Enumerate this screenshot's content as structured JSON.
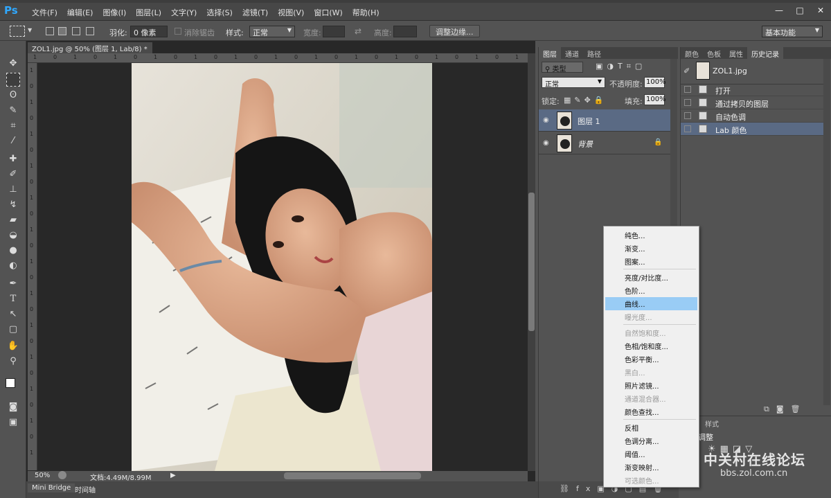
{
  "menubar": {
    "logo": "Ps",
    "items": [
      "文件(F)",
      "编辑(E)",
      "图像(I)",
      "图层(L)",
      "文字(Y)",
      "选择(S)",
      "滤镜(T)",
      "视图(V)",
      "窗口(W)",
      "帮助(H)"
    ],
    "controls": [
      "—",
      "□",
      "✕"
    ]
  },
  "options": {
    "feather_label": "羽化:",
    "feather_value": "0 像素",
    "antialias_label": "消除锯齿",
    "style_label": "样式:",
    "style_value": "正常",
    "width_label": "宽度:",
    "height_label": "高度:",
    "refine_button": "调整边缘...",
    "workspace": "基本功能"
  },
  "document": {
    "tab_title": "ZOL1.jpg @ 50% (图层 1, Lab/8) *",
    "tab_close": "×",
    "zoom": "50%",
    "doc_info": "文档:4.49M/8.99M",
    "ruler_h": [
      "1",
      "0",
      "1",
      "0",
      "1",
      "0",
      "1",
      "0",
      "1",
      "0",
      "1",
      "0",
      "1",
      "0",
      "1",
      "0",
      "1",
      "0",
      "1",
      "0",
      "1",
      "0",
      "1",
      "0",
      "1"
    ],
    "ruler_v": [
      "1",
      "0",
      "1",
      "0",
      "1",
      "0",
      "1",
      "0",
      "1",
      "0",
      "1",
      "0",
      "1",
      "0",
      "1",
      "0",
      "1",
      "0",
      "1",
      "0",
      "1",
      "0",
      "1",
      "0",
      "1"
    ]
  },
  "bottom_tabs": [
    "Mini Bridge",
    "时间轴"
  ],
  "layers_panel": {
    "tabs": [
      "图层",
      "通道",
      "路径"
    ],
    "filter_label": "类型",
    "blend_mode": "正常",
    "opacity_label": "不透明度:",
    "opacity_value": "100%",
    "lock_label": "锁定:",
    "fill_label": "填充:",
    "fill_value": "100%",
    "layers": [
      {
        "name": "图层 1",
        "selected": true
      },
      {
        "name": "背景",
        "selected": false,
        "locked": true
      }
    ]
  },
  "history_panel": {
    "tabs": [
      "颜色",
      "色板",
      "属性",
      "历史记录"
    ],
    "snapshot": "ZOL1.jpg",
    "steps": [
      {
        "name": "打开",
        "selected": false
      },
      {
        "name": "通过拷贝的图层",
        "selected": false
      },
      {
        "name": "自动色调",
        "selected": false
      },
      {
        "name": "Lab 颜色",
        "selected": true
      }
    ]
  },
  "adj_panel": {
    "tab": "样式",
    "title": "调整"
  },
  "context_menu": {
    "groups": [
      [
        {
          "label": "纯色...",
          "enabled": true
        },
        {
          "label": "渐变...",
          "enabled": true
        },
        {
          "label": "图案...",
          "enabled": true
        }
      ],
      [
        {
          "label": "亮度/对比度...",
          "enabled": true
        },
        {
          "label": "色阶...",
          "enabled": true
        },
        {
          "label": "曲线...",
          "enabled": true,
          "highlighted": true
        },
        {
          "label": "曝光度...",
          "enabled": false
        }
      ],
      [
        {
          "label": "自然饱和度...",
          "enabled": false
        },
        {
          "label": "色相/饱和度...",
          "enabled": true
        },
        {
          "label": "色彩平衡...",
          "enabled": true
        },
        {
          "label": "黑白...",
          "enabled": false
        },
        {
          "label": "照片滤镜...",
          "enabled": true
        },
        {
          "label": "通道混合器...",
          "enabled": false
        },
        {
          "label": "颜色查找...",
          "enabled": true
        }
      ],
      [
        {
          "label": "反相",
          "enabled": true
        },
        {
          "label": "色调分离...",
          "enabled": true
        },
        {
          "label": "阈值...",
          "enabled": true
        },
        {
          "label": "渐变映射...",
          "enabled": true
        },
        {
          "label": "可选颜色...",
          "enabled": false
        }
      ]
    ]
  },
  "watermark": {
    "line1": "中关村在线论坛",
    "line2": "bbs.zol.com.cn"
  }
}
